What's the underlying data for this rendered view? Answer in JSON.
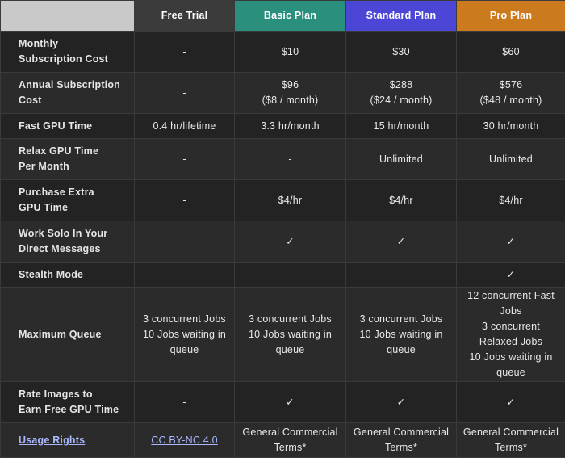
{
  "columns": [
    "Free Trial",
    "Basic Plan",
    "Standard Plan",
    "Pro Plan"
  ],
  "rows": [
    {
      "label": "Monthly\nSubscription Cost",
      "cells": [
        "-",
        "$10",
        "$30",
        "$60"
      ]
    },
    {
      "label": "Annual Subscription\nCost",
      "cells": [
        "-",
        "$96\n($8 / month)",
        "$288\n($24 / month)",
        "$576\n($48 / month)"
      ]
    },
    {
      "label": "Fast GPU Time",
      "cells": [
        "0.4 hr/lifetime",
        "3.3 hr/month",
        "15 hr/month",
        "30 hr/month"
      ]
    },
    {
      "label": "Relax GPU Time\nPer Month",
      "cells": [
        "-",
        "-",
        "Unlimited",
        "Unlimited"
      ]
    },
    {
      "label": "Purchase Extra\nGPU Time",
      "cells": [
        "-",
        "$4/hr",
        "$4/hr",
        "$4/hr"
      ]
    },
    {
      "label": "Work Solo In Your\nDirect Messages",
      "cells": [
        "-",
        "✓",
        "✓",
        "✓"
      ]
    },
    {
      "label": "Stealth Mode",
      "cells": [
        "-",
        "-",
        "-",
        "✓"
      ]
    },
    {
      "label": "Maximum Queue",
      "cells": [
        "3 concurrent Jobs\n10 Jobs waiting in\nqueue",
        "3 concurrent Jobs\n10 Jobs waiting in\nqueue",
        "3 concurrent Jobs\n10 Jobs waiting in\nqueue",
        "12 concurrent Fast\nJobs\n3 concurrent\nRelaxed Jobs\n10 Jobs waiting in\nqueue"
      ]
    },
    {
      "label": "Rate Images to\nEarn Free GPU Time",
      "cells": [
        "-",
        "✓",
        "✓",
        "✓"
      ]
    },
    {
      "label": "Usage Rights",
      "label_link": true,
      "cells": [
        "CC BY-NC 4.0",
        "General Commercial\nTerms*",
        "General Commercial\nTerms*",
        "General Commercial\nTerms*"
      ],
      "cell_links": [
        true,
        false,
        false,
        false
      ]
    }
  ],
  "colors": {
    "free_header": "#3b3b3b",
    "basic_header": "#2b8f7e",
    "standard_header": "#4b46d6",
    "pro_header": "#cc7a1e",
    "link": "#a9b8ff"
  }
}
